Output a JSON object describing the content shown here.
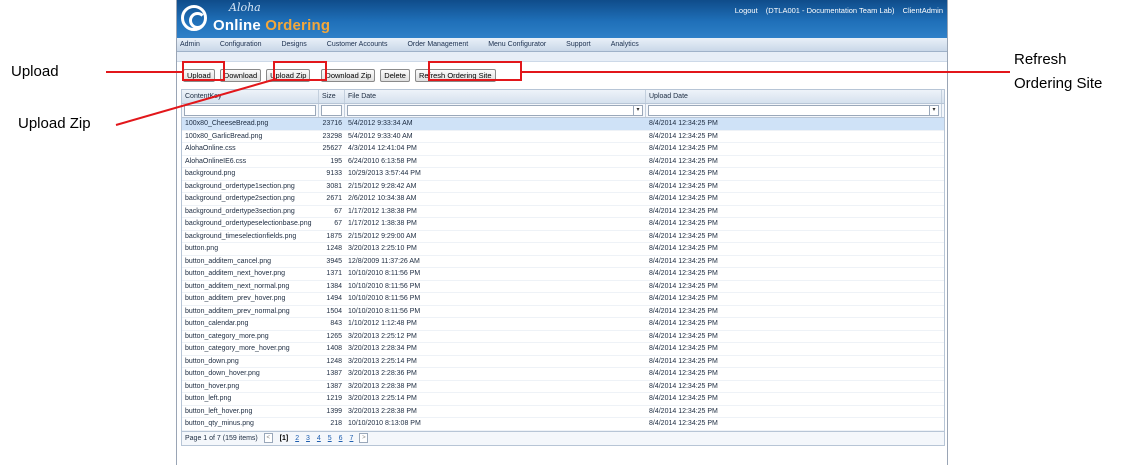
{
  "header": {
    "brand_script": "Aloha",
    "brand_main_a": "Online ",
    "brand_main_b": "Ordering",
    "links": [
      "Logout",
      "(DTLA001 - Documentation Team Lab)",
      "ClientAdmin"
    ]
  },
  "menu": [
    "Admin",
    "Configuration",
    "Designs",
    "Customer Accounts",
    "Order Management",
    "Menu Configurator",
    "Support",
    "Analytics"
  ],
  "toolbar": {
    "upload": "Upload",
    "download": "Download",
    "upload_zip": "Upload Zip",
    "download_zip": "Download Zip",
    "delete": "Delete",
    "refresh": "Refresh Ordering Site"
  },
  "grid": {
    "columns": [
      "ContentKey",
      "Size",
      "File Date",
      "Upload Date"
    ],
    "rows": [
      {
        "key": "100x80_CheeseBread.png",
        "size": "23716",
        "file_date": "5/4/2012 9:33:34 AM",
        "upload_date": "8/4/2014 12:34:25 PM"
      },
      {
        "key": "100x80_GarlicBread.png",
        "size": "23298",
        "file_date": "5/4/2012 9:33:40 AM",
        "upload_date": "8/4/2014 12:34:25 PM"
      },
      {
        "key": "AlohaOnline.css",
        "size": "25627",
        "file_date": "4/3/2014 12:41:04 PM",
        "upload_date": "8/4/2014 12:34:25 PM"
      },
      {
        "key": "AlohaOnlineIE6.css",
        "size": "195",
        "file_date": "6/24/2010 6:13:58 PM",
        "upload_date": "8/4/2014 12:34:25 PM"
      },
      {
        "key": "background.png",
        "size": "9133",
        "file_date": "10/29/2013 3:57:44 PM",
        "upload_date": "8/4/2014 12:34:25 PM"
      },
      {
        "key": "background_ordertype1section.png",
        "size": "3081",
        "file_date": "2/15/2012 9:28:42 AM",
        "upload_date": "8/4/2014 12:34:25 PM"
      },
      {
        "key": "background_ordertype2section.png",
        "size": "2671",
        "file_date": "2/6/2012 10:34:38 AM",
        "upload_date": "8/4/2014 12:34:25 PM"
      },
      {
        "key": "background_ordertype3section.png",
        "size": "67",
        "file_date": "1/17/2012 1:38:38 PM",
        "upload_date": "8/4/2014 12:34:25 PM"
      },
      {
        "key": "background_ordertypeselectionbase.png",
        "size": "67",
        "file_date": "1/17/2012 1:38:38 PM",
        "upload_date": "8/4/2014 12:34:25 PM"
      },
      {
        "key": "background_timeselectionfields.png",
        "size": "1875",
        "file_date": "2/15/2012 9:29:00 AM",
        "upload_date": "8/4/2014 12:34:25 PM"
      },
      {
        "key": "button.png",
        "size": "1248",
        "file_date": "3/20/2013 2:25:10 PM",
        "upload_date": "8/4/2014 12:34:25 PM"
      },
      {
        "key": "button_additem_cancel.png",
        "size": "3945",
        "file_date": "12/8/2009 11:37:26 AM",
        "upload_date": "8/4/2014 12:34:25 PM"
      },
      {
        "key": "button_additem_next_hover.png",
        "size": "1371",
        "file_date": "10/10/2010 8:11:56 PM",
        "upload_date": "8/4/2014 12:34:25 PM"
      },
      {
        "key": "button_additem_next_normal.png",
        "size": "1384",
        "file_date": "10/10/2010 8:11:56 PM",
        "upload_date": "8/4/2014 12:34:25 PM"
      },
      {
        "key": "button_additem_prev_hover.png",
        "size": "1494",
        "file_date": "10/10/2010 8:11:56 PM",
        "upload_date": "8/4/2014 12:34:25 PM"
      },
      {
        "key": "button_additem_prev_normal.png",
        "size": "1504",
        "file_date": "10/10/2010 8:11:56 PM",
        "upload_date": "8/4/2014 12:34:25 PM"
      },
      {
        "key": "button_calendar.png",
        "size": "843",
        "file_date": "1/10/2012 1:12:48 PM",
        "upload_date": "8/4/2014 12:34:25 PM"
      },
      {
        "key": "button_category_more.png",
        "size": "1265",
        "file_date": "3/20/2013 2:25:12 PM",
        "upload_date": "8/4/2014 12:34:25 PM"
      },
      {
        "key": "button_category_more_hover.png",
        "size": "1408",
        "file_date": "3/20/2013 2:28:34 PM",
        "upload_date": "8/4/2014 12:34:25 PM"
      },
      {
        "key": "button_down.png",
        "size": "1248",
        "file_date": "3/20/2013 2:25:14 PM",
        "upload_date": "8/4/2014 12:34:25 PM"
      },
      {
        "key": "button_down_hover.png",
        "size": "1387",
        "file_date": "3/20/2013 2:28:36 PM",
        "upload_date": "8/4/2014 12:34:25 PM"
      },
      {
        "key": "button_hover.png",
        "size": "1387",
        "file_date": "3/20/2013 2:28:38 PM",
        "upload_date": "8/4/2014 12:34:25 PM"
      },
      {
        "key": "button_left.png",
        "size": "1219",
        "file_date": "3/20/2013 2:25:14 PM",
        "upload_date": "8/4/2014 12:34:25 PM"
      },
      {
        "key": "button_left_hover.png",
        "size": "1399",
        "file_date": "3/20/2013 2:28:38 PM",
        "upload_date": "8/4/2014 12:34:25 PM"
      },
      {
        "key": "button_qty_minus.png",
        "size": "218",
        "file_date": "10/10/2010 8:13:08 PM",
        "upload_date": "8/4/2014 12:34:25 PM"
      }
    ],
    "selected_row": 0
  },
  "pager": {
    "summary": "Page 1 of 7 (159 items)",
    "prev": "<",
    "current": "[1]",
    "pages": [
      "2",
      "3",
      "4",
      "5",
      "6",
      "7"
    ],
    "next": ">"
  },
  "callouts": {
    "upload": "Upload",
    "upload_zip": "Upload Zip",
    "refresh_line1": "Refresh",
    "refresh_line2": "Ordering Site"
  },
  "colors": {
    "header": "#1f6fb8",
    "highlight": "#e2171b",
    "selected_row": "#cfe2f7"
  }
}
